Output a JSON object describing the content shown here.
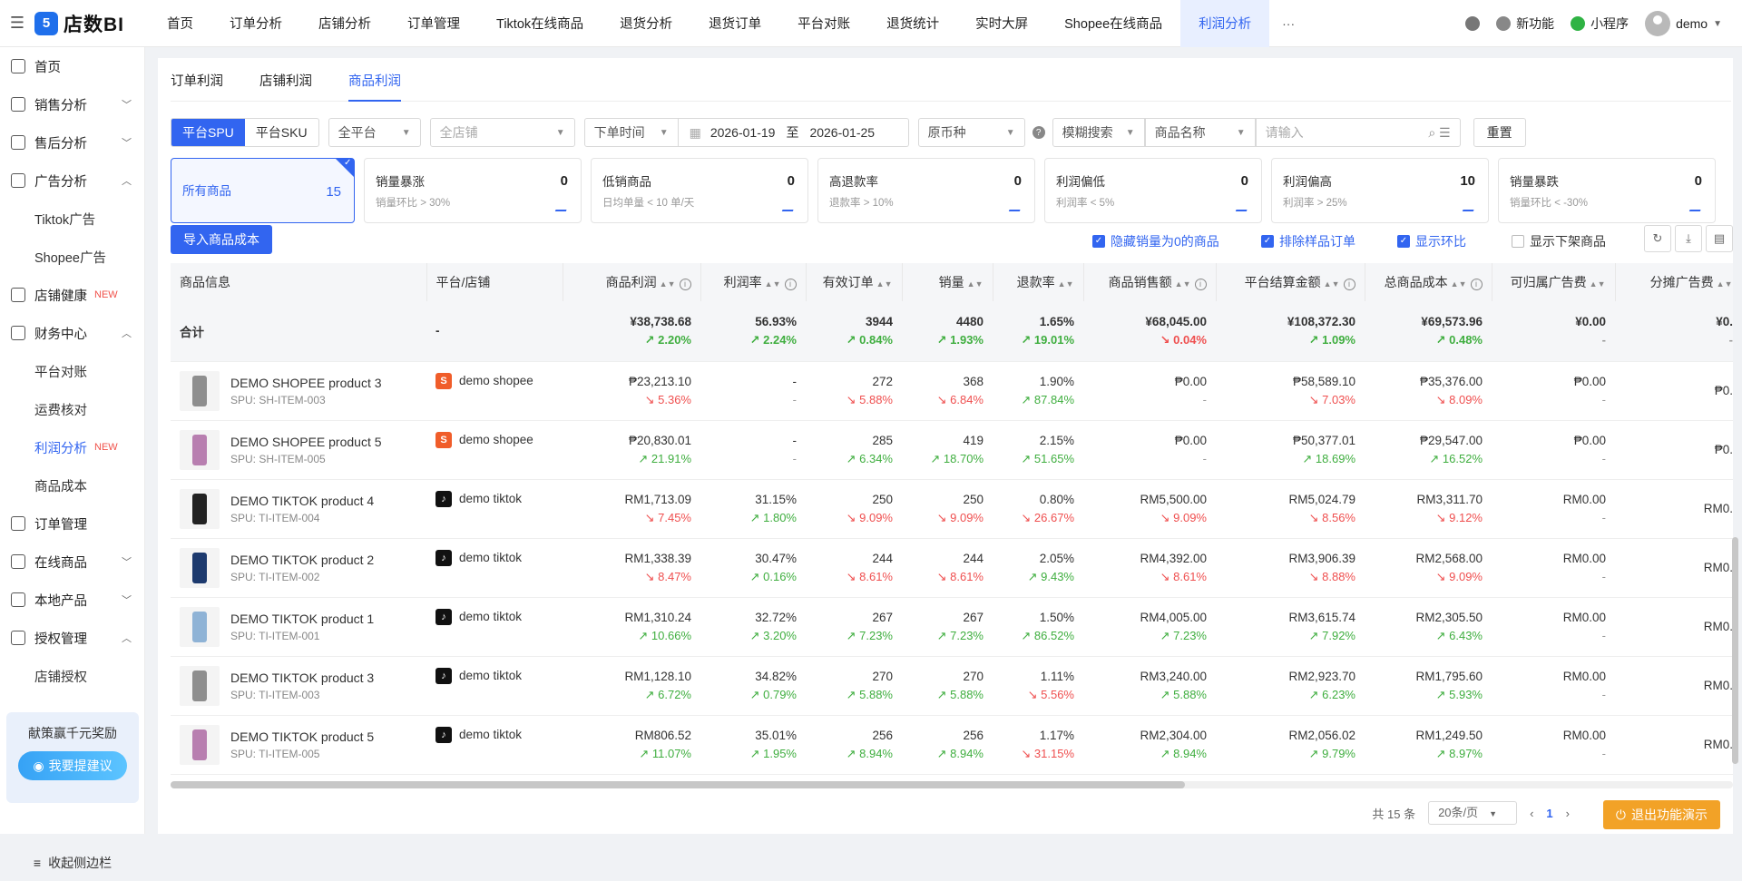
{
  "app": {
    "logo_badge": "5",
    "logo_text": "店数BI"
  },
  "topnav": {
    "items": [
      "首页",
      "订单分析",
      "店铺分析",
      "订单管理",
      "Tiktok在线商品",
      "退货分析",
      "退货订单",
      "平台对账",
      "退货统计",
      "实时大屏",
      "Shopee在线商品",
      "利润分析"
    ],
    "active": "利润分析",
    "more": "···"
  },
  "topright": {
    "new_feature": "新功能",
    "miniapp": "小程序",
    "user": "demo"
  },
  "sidebar": {
    "items": [
      {
        "label": "首页",
        "icon": "home-icon"
      },
      {
        "label": "销售分析",
        "icon": "sales-icon",
        "chev": "﹀"
      },
      {
        "label": "售后分析",
        "icon": "aftersale-icon",
        "chev": "﹀"
      },
      {
        "label": "广告分析",
        "icon": "ad-icon",
        "chev": "︿"
      },
      {
        "label": "Tiktok广告",
        "sub": true
      },
      {
        "label": "Shopee广告",
        "sub": true
      },
      {
        "label": "店铺健康",
        "icon": "shop-health-icon",
        "tag": "NEW"
      },
      {
        "label": "财务中心",
        "icon": "finance-icon",
        "chev": "︿"
      },
      {
        "label": "平台对账",
        "sub": true
      },
      {
        "label": "运费核对",
        "sub": true
      },
      {
        "label": "利润分析",
        "sub": true,
        "active": true,
        "tag": "NEW"
      },
      {
        "label": "商品成本",
        "sub": true
      },
      {
        "label": "订单管理",
        "icon": "order-icon"
      },
      {
        "label": "在线商品",
        "icon": "online-goods-icon",
        "chev": "﹀"
      },
      {
        "label": "本地产品",
        "icon": "local-product-icon",
        "chev": "﹀"
      },
      {
        "label": "授权管理",
        "icon": "auth-icon",
        "chev": "︿"
      },
      {
        "label": "店铺授权",
        "sub": true
      }
    ],
    "promo_text": "献策赢千元奖励",
    "promo_button": "我要提建议",
    "collapse": "收起侧边栏"
  },
  "tabs": [
    "订单利润",
    "店铺利润",
    "商品利润"
  ],
  "active_tab": "商品利润",
  "filters": {
    "seg": [
      "平台SPU",
      "平台SKU"
    ],
    "platform": "全平台",
    "shop_placeholder": "全店铺",
    "time_type": "下单时间",
    "date_start": "2026-01-19",
    "date_sep": "至",
    "date_end": "2026-01-25",
    "currency": "原币种",
    "help": "?",
    "search_mode": "模糊搜索",
    "search_field": "商品名称",
    "search_placeholder": "请输入",
    "reset": "重置"
  },
  "kpis": [
    {
      "name": "所有商品",
      "value": "15",
      "selected": true
    },
    {
      "name": "销量暴涨",
      "sub": "销量环比 > 30%",
      "value": "0"
    },
    {
      "name": "低销商品",
      "sub": "日均单量 < 10 单/天",
      "value": "0"
    },
    {
      "name": "高退款率",
      "sub": "退款率 > 10%",
      "value": "0"
    },
    {
      "name": "利润偏低",
      "sub": "利润率 < 5%",
      "value": "0"
    },
    {
      "name": "利润偏高",
      "sub": "利润率 > 25%",
      "value": "10"
    },
    {
      "name": "销量暴跌",
      "sub": "销量环比 < -30%",
      "value": "0"
    }
  ],
  "toolbar": {
    "import": "导入商品成本",
    "checks": [
      {
        "label": "隐藏销量为0的商品",
        "checked": true
      },
      {
        "label": "排除样品订单",
        "checked": true
      },
      {
        "label": "显示环比",
        "checked": true
      },
      {
        "label": "显示下架商品",
        "checked": false
      }
    ]
  },
  "table": {
    "headers": [
      "商品信息",
      "平台/店铺",
      "商品利润",
      "利润率",
      "有效订单",
      "销量",
      "退款率",
      "商品销售额",
      "平台结算金额",
      "总商品成本",
      "可归属广告费",
      "分摊广告费"
    ],
    "total": {
      "label": "合计",
      "platform": "-",
      "cells": [
        {
          "v": "¥38,738.68",
          "c": "2.20%",
          "d": "up"
        },
        {
          "v": "56.93%",
          "c": "2.24%",
          "d": "up"
        },
        {
          "v": "3944",
          "c": "0.84%",
          "d": "up"
        },
        {
          "v": "4480",
          "c": "1.93%",
          "d": "up"
        },
        {
          "v": "1.65%",
          "c": "19.01%",
          "d": "up"
        },
        {
          "v": "¥68,045.00",
          "c": "0.04%",
          "d": "dn"
        },
        {
          "v": "¥108,372.30",
          "c": "1.09%",
          "d": "up"
        },
        {
          "v": "¥69,573.96",
          "c": "0.48%",
          "d": "up"
        },
        {
          "v": "¥0.00",
          "c": "-",
          "d": "none"
        },
        {
          "v": "¥0.",
          "c": "-",
          "d": "none"
        }
      ]
    },
    "rows": [
      {
        "name": "DEMO SHOPEE product 3",
        "spu": "SPU: SH-ITEM-003",
        "platform": "shopee",
        "shop": "demo shopee",
        "color": "#8e8e8e",
        "cells": [
          {
            "v": "₱23,213.10",
            "c": "5.36%",
            "d": "dn"
          },
          {
            "v": "-",
            "c": "-",
            "d": "none"
          },
          {
            "v": "272",
            "c": "5.88%",
            "d": "dn"
          },
          {
            "v": "368",
            "c": "6.84%",
            "d": "dn"
          },
          {
            "v": "1.90%",
            "c": "87.84%",
            "d": "up"
          },
          {
            "v": "₱0.00",
            "c": "-",
            "d": "none"
          },
          {
            "v": "₱58,589.10",
            "c": "7.03%",
            "d": "dn"
          },
          {
            "v": "₱35,376.00",
            "c": "8.09%",
            "d": "dn"
          },
          {
            "v": "₱0.00",
            "c": "-",
            "d": "none"
          },
          {
            "v": "₱0.",
            "c": "",
            "d": "none"
          }
        ]
      },
      {
        "name": "DEMO SHOPEE product 5",
        "spu": "SPU: SH-ITEM-005",
        "platform": "shopee",
        "shop": "demo shopee",
        "color": "#b87fb0",
        "cells": [
          {
            "v": "₱20,830.01",
            "c": "21.91%",
            "d": "up"
          },
          {
            "v": "-",
            "c": "-",
            "d": "none"
          },
          {
            "v": "285",
            "c": "6.34%",
            "d": "up"
          },
          {
            "v": "419",
            "c": "18.70%",
            "d": "up"
          },
          {
            "v": "2.15%",
            "c": "51.65%",
            "d": "up"
          },
          {
            "v": "₱0.00",
            "c": "-",
            "d": "none"
          },
          {
            "v": "₱50,377.01",
            "c": "18.69%",
            "d": "up"
          },
          {
            "v": "₱29,547.00",
            "c": "16.52%",
            "d": "up"
          },
          {
            "v": "₱0.00",
            "c": "-",
            "d": "none"
          },
          {
            "v": "₱0.",
            "c": "",
            "d": "none"
          }
        ]
      },
      {
        "name": "DEMO TIKTOK product 4",
        "spu": "SPU: TI-ITEM-004",
        "platform": "tiktok",
        "shop": "demo tiktok",
        "color": "#222222",
        "cells": [
          {
            "v": "RM1,713.09",
            "c": "7.45%",
            "d": "dn"
          },
          {
            "v": "31.15%",
            "c": "1.80%",
            "d": "up"
          },
          {
            "v": "250",
            "c": "9.09%",
            "d": "dn"
          },
          {
            "v": "250",
            "c": "9.09%",
            "d": "dn"
          },
          {
            "v": "0.80%",
            "c": "26.67%",
            "d": "dn"
          },
          {
            "v": "RM5,500.00",
            "c": "9.09%",
            "d": "dn"
          },
          {
            "v": "RM5,024.79",
            "c": "8.56%",
            "d": "dn"
          },
          {
            "v": "RM3,311.70",
            "c": "9.12%",
            "d": "dn"
          },
          {
            "v": "RM0.00",
            "c": "-",
            "d": "none"
          },
          {
            "v": "RM0.",
            "c": "",
            "d": "none"
          }
        ]
      },
      {
        "name": "DEMO TIKTOK product 2",
        "spu": "SPU: TI-ITEM-002",
        "platform": "tiktok",
        "shop": "demo tiktok",
        "color": "#1d3a6e",
        "cells": [
          {
            "v": "RM1,338.39",
            "c": "8.47%",
            "d": "dn"
          },
          {
            "v": "30.47%",
            "c": "0.16%",
            "d": "up"
          },
          {
            "v": "244",
            "c": "8.61%",
            "d": "dn"
          },
          {
            "v": "244",
            "c": "8.61%",
            "d": "dn"
          },
          {
            "v": "2.05%",
            "c": "9.43%",
            "d": "up"
          },
          {
            "v": "RM4,392.00",
            "c": "8.61%",
            "d": "dn"
          },
          {
            "v": "RM3,906.39",
            "c": "8.88%",
            "d": "dn"
          },
          {
            "v": "RM2,568.00",
            "c": "9.09%",
            "d": "dn"
          },
          {
            "v": "RM0.00",
            "c": "-",
            "d": "none"
          },
          {
            "v": "RM0.",
            "c": "",
            "d": "none"
          }
        ]
      },
      {
        "name": "DEMO TIKTOK product 1",
        "spu": "SPU: TI-ITEM-001",
        "platform": "tiktok",
        "shop": "demo tiktok",
        "color": "#8fb3d6",
        "cells": [
          {
            "v": "RM1,310.24",
            "c": "10.66%",
            "d": "up"
          },
          {
            "v": "32.72%",
            "c": "3.20%",
            "d": "up"
          },
          {
            "v": "267",
            "c": "7.23%",
            "d": "up"
          },
          {
            "v": "267",
            "c": "7.23%",
            "d": "up"
          },
          {
            "v": "1.50%",
            "c": "86.52%",
            "d": "up"
          },
          {
            "v": "RM4,005.00",
            "c": "7.23%",
            "d": "up"
          },
          {
            "v": "RM3,615.74",
            "c": "7.92%",
            "d": "up"
          },
          {
            "v": "RM2,305.50",
            "c": "6.43%",
            "d": "up"
          },
          {
            "v": "RM0.00",
            "c": "-",
            "d": "none"
          },
          {
            "v": "RM0.",
            "c": "",
            "d": "none"
          }
        ]
      },
      {
        "name": "DEMO TIKTOK product 3",
        "spu": "SPU: TI-ITEM-003",
        "platform": "tiktok",
        "shop": "demo tiktok",
        "color": "#8e8e8e",
        "cells": [
          {
            "v": "RM1,128.10",
            "c": "6.72%",
            "d": "up"
          },
          {
            "v": "34.82%",
            "c": "0.79%",
            "d": "up"
          },
          {
            "v": "270",
            "c": "5.88%",
            "d": "up"
          },
          {
            "v": "270",
            "c": "5.88%",
            "d": "up"
          },
          {
            "v": "1.11%",
            "c": "5.56%",
            "d": "dn"
          },
          {
            "v": "RM3,240.00",
            "c": "5.88%",
            "d": "up"
          },
          {
            "v": "RM2,923.70",
            "c": "6.23%",
            "d": "up"
          },
          {
            "v": "RM1,795.60",
            "c": "5.93%",
            "d": "up"
          },
          {
            "v": "RM0.00",
            "c": "-",
            "d": "none"
          },
          {
            "v": "RM0.",
            "c": "",
            "d": "none"
          }
        ]
      },
      {
        "name": "DEMO TIKTOK product 5",
        "spu": "SPU: TI-ITEM-005",
        "platform": "tiktok",
        "shop": "demo tiktok",
        "color": "#b87fb0",
        "cells": [
          {
            "v": "RM806.52",
            "c": "11.07%",
            "d": "up"
          },
          {
            "v": "35.01%",
            "c": "1.95%",
            "d": "up"
          },
          {
            "v": "256",
            "c": "8.94%",
            "d": "up"
          },
          {
            "v": "256",
            "c": "8.94%",
            "d": "up"
          },
          {
            "v": "1.17%",
            "c": "31.15%",
            "d": "dn"
          },
          {
            "v": "RM2,304.00",
            "c": "8.94%",
            "d": "up"
          },
          {
            "v": "RM2,056.02",
            "c": "9.79%",
            "d": "up"
          },
          {
            "v": "RM1,249.50",
            "c": "8.97%",
            "d": "up"
          },
          {
            "v": "RM0.00",
            "c": "-",
            "d": "none"
          },
          {
            "v": "RM0.",
            "c": "",
            "d": "none"
          }
        ]
      }
    ]
  },
  "pagination": {
    "total": "共 15 条",
    "page_size": "20条/页",
    "page": "1"
  },
  "exit_demo": "退出功能演示",
  "colors": {
    "accent": "#3265f0",
    "up": "#3fae3f",
    "down": "#ef4f4f",
    "shopee": "#f05d2a",
    "tiktok": "#111111",
    "demo_btn": "#f2a227"
  }
}
